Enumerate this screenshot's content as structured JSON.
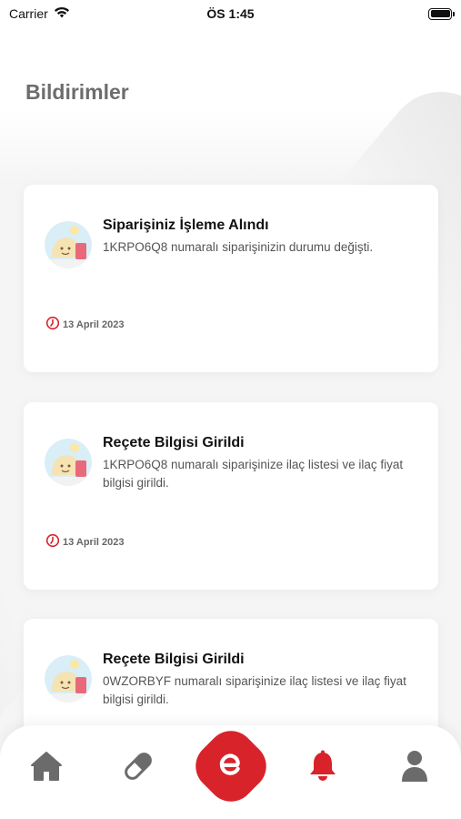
{
  "status_bar": {
    "carrier": "Carrier",
    "time": "ÖS 1:45"
  },
  "page": {
    "title": "Bildirimler"
  },
  "notifications": [
    {
      "title": "Siparişiniz İşleme Alındı",
      "description": "1KRPO6Q8 numaralı siparişinizin durumu değişti.",
      "date": "13 April 2023"
    },
    {
      "title": "Reçete Bilgisi Girildi",
      "description": "1KRPO6Q8 numaralı siparişinize ilaç listesi ve ilaç fiyat bilgisi girildi.",
      "date": "13 April 2023"
    },
    {
      "title": "Reçete Bilgisi Girildi",
      "description": "0WZORBYF numaralı siparişinize ilaç listesi ve ilaç fiyat bilgisi girildi.",
      "date": ""
    }
  ],
  "bottom_nav": {
    "items": [
      {
        "icon": "home-icon",
        "active": false
      },
      {
        "icon": "pill-icon",
        "active": false
      },
      {
        "icon": "brand-e-icon",
        "active": false
      },
      {
        "icon": "bell-icon",
        "active": true
      },
      {
        "icon": "user-icon",
        "active": false
      }
    ]
  },
  "colors": {
    "accent": "#d8232a",
    "nav_inactive": "#6b6b6b",
    "title_gray": "#6d6d6d",
    "background": "#f5f5f5"
  }
}
